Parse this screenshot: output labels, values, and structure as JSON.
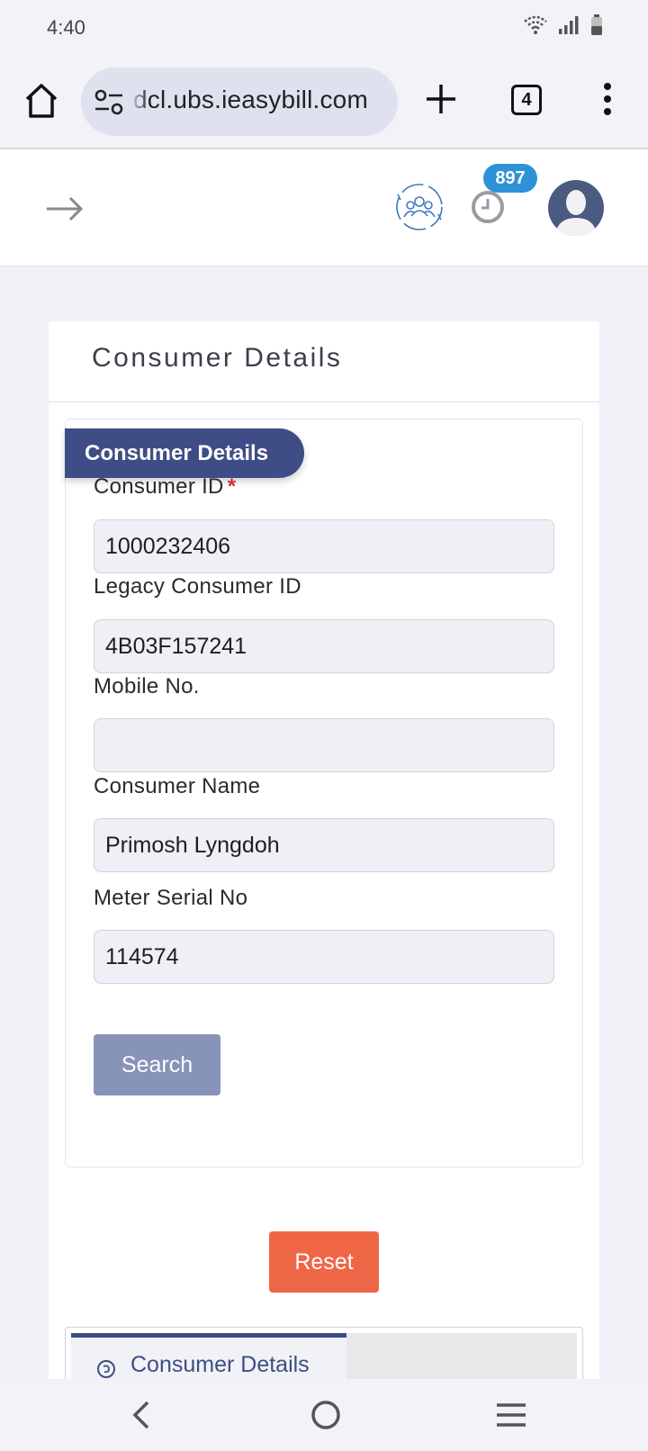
{
  "status_bar": {
    "time": "4:40",
    "icons": [
      "wifi-icon",
      "signal-icon",
      "battery-icon"
    ]
  },
  "browser": {
    "url": "dcl.ubs.ieasybill.com",
    "tab_count": "4",
    "icons": [
      "home-icon",
      "site-settings-icon",
      "new-tab-icon",
      "tabs-icon",
      "more-menu-icon"
    ]
  },
  "header": {
    "notification_count": "897",
    "icons": [
      "arrow-right-icon",
      "team-sync-icon",
      "clock-icon",
      "avatar"
    ]
  },
  "page": {
    "title": "Consumer Details",
    "section_label": "Consumer Details",
    "fields": [
      {
        "label": "Consumer ID",
        "required_mark": "*",
        "value": "1000232406"
      },
      {
        "label": "Legacy Consumer ID",
        "value": "4B03F157241"
      },
      {
        "label": "Mobile No.",
        "value": ""
      },
      {
        "label": "Consumer Name",
        "value": "Primosh Lyngdoh"
      },
      {
        "label": "Meter Serial No",
        "value": "114574"
      }
    ],
    "search_label": "Search",
    "reset_label": "Reset",
    "tab_label": "Consumer Details"
  },
  "colors": {
    "primary": "#3f4d86",
    "search_button": "#8793b8",
    "reset_button": "#ef6647",
    "badge": "#2e92d8",
    "required": "#d32f2f"
  },
  "nav_bar": {
    "icons": [
      "back-icon",
      "home-circle-icon",
      "recents-icon"
    ]
  }
}
